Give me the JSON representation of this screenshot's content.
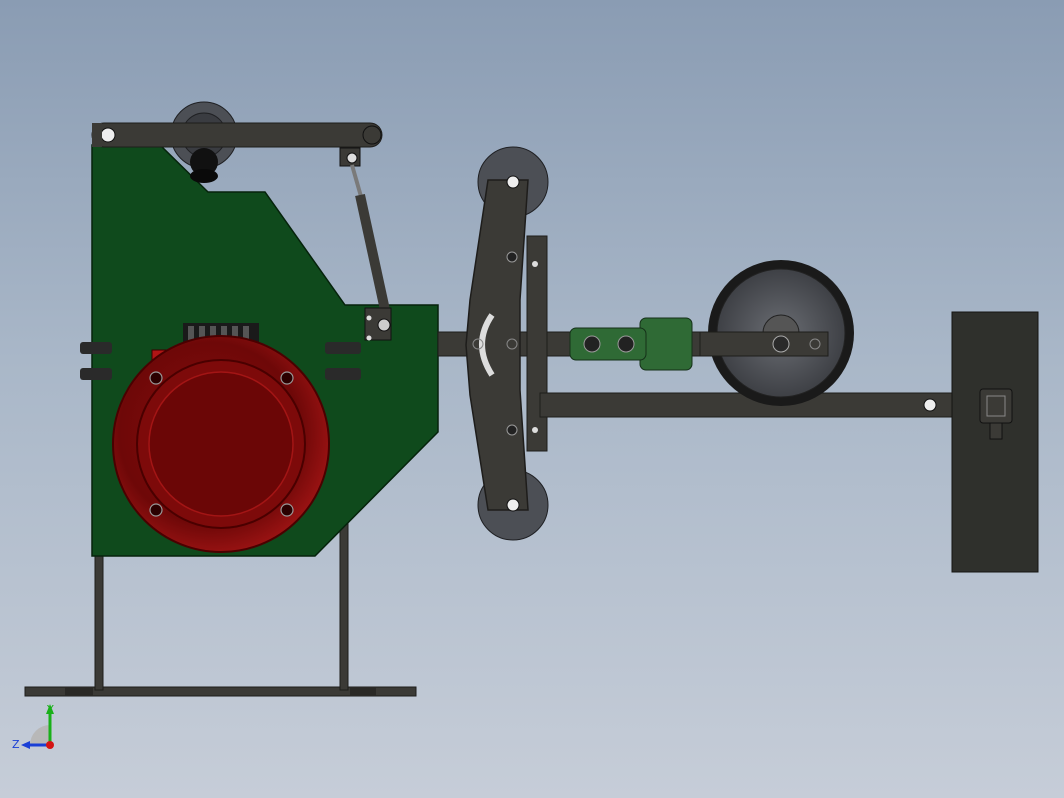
{
  "viewport": {
    "background_top": "#8a9cb3",
    "background_bottom": "#c6cdd8"
  },
  "model": {
    "frame_color": "#3b3a36",
    "housing_color": "#0f4a1c",
    "motor_color": "#7a0a0a",
    "wheel_color": "#4c4f55",
    "counterweight_color": "#2f302c"
  },
  "triad": {
    "axis_y": "Y",
    "axis_z": "Z",
    "y_color": "#19b019",
    "z_color": "#1a3fd6",
    "x_color": "#d41414"
  }
}
